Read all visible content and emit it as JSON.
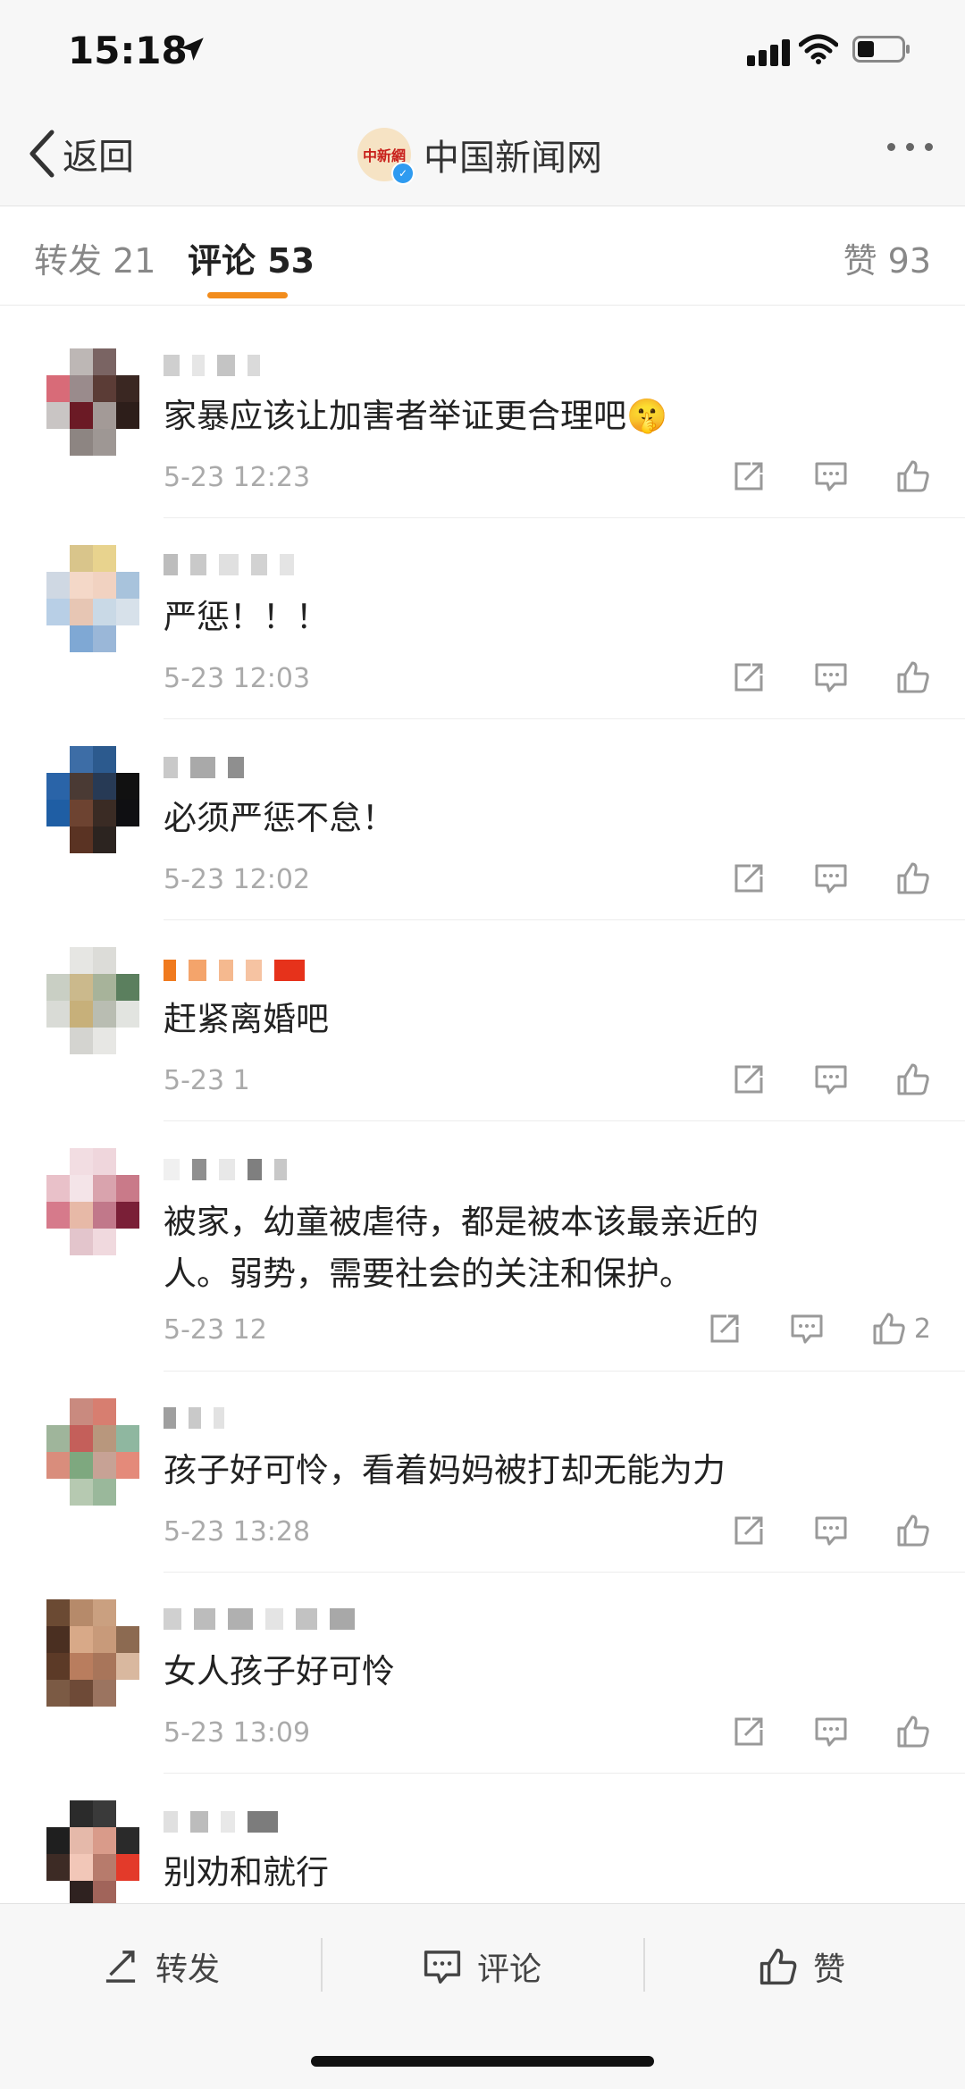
{
  "status_bar": {
    "time": "15:18"
  },
  "nav": {
    "back_label": "返回",
    "account_name": "中国新闻网",
    "logo_text": "中新網"
  },
  "tabs": {
    "repost": "转发 21",
    "comment": "评论 53",
    "likes": "赞 93"
  },
  "comments": [
    {
      "text": "家暴应该让加害者举证更合理吧",
      "emoji": "🤫",
      "time": "5-23 12:23"
    },
    {
      "text": "严惩！！！",
      "time": "5-23 12:03"
    },
    {
      "text": "必须严惩不怠！",
      "time": "5-23 12:02"
    },
    {
      "text": "赶紧离婚吧",
      "time": "5-23 1"
    },
    {
      "text_line1": "被家，幼童被虐待，都是被本该最亲近的",
      "text_line2": "人。弱势，需要社会的关注和保护。",
      "time": "5-23 12",
      "like_count": "2"
    },
    {
      "text": "孩子好可怜，看着妈妈被打却无能为力",
      "time": "5-23 13:28"
    },
    {
      "text": "女人孩子好可怜",
      "time": "5-23 13:09"
    },
    {
      "text": "别劝和就行"
    }
  ],
  "bottom_bar": {
    "repost": "转发",
    "comment": "评论",
    "like": "赞"
  },
  "colors": {
    "accent": "#f28c1c",
    "verified": "#2f9bf0",
    "logo_red": "#c8201b"
  }
}
